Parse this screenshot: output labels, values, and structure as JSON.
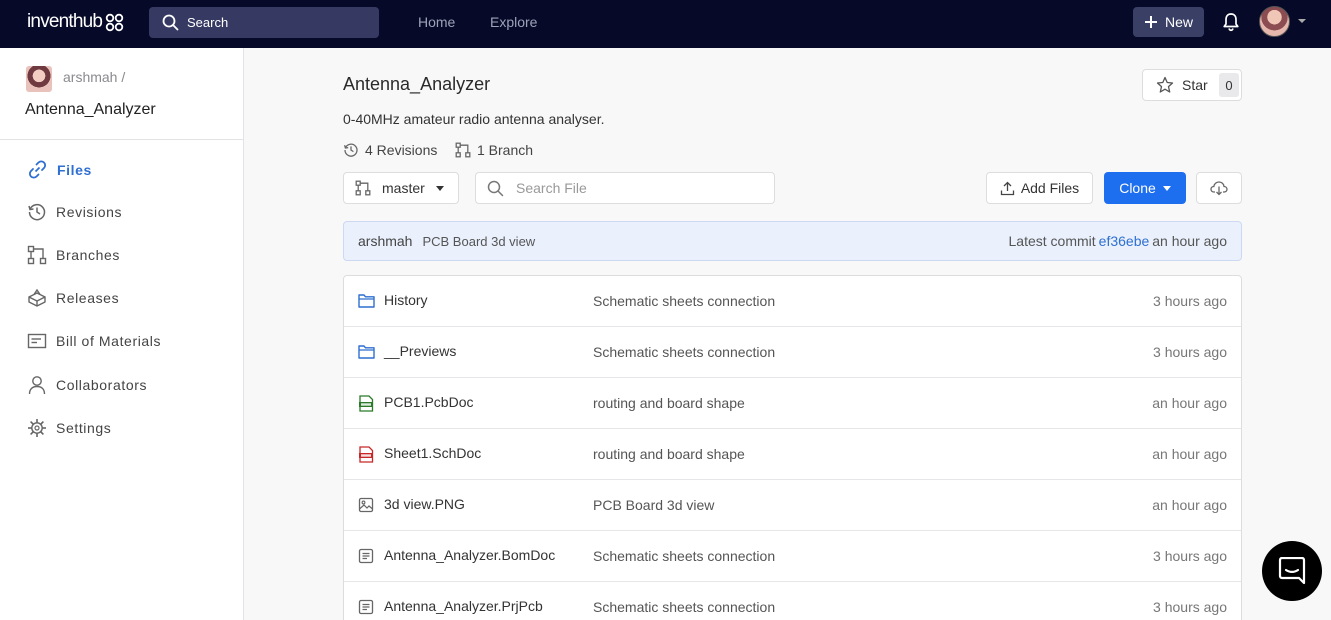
{
  "topbar": {
    "brand": "inventhub",
    "search_placeholder": "Search",
    "nav": [
      {
        "label": "Home"
      },
      {
        "label": "Explore"
      }
    ],
    "new_label": "New"
  },
  "sidebar": {
    "owner": "arshmah /",
    "repo": "Antenna_Analyzer",
    "items": [
      {
        "label": "Files",
        "icon": "link-icon",
        "active": true
      },
      {
        "label": "Revisions",
        "icon": "history-icon"
      },
      {
        "label": "Branches",
        "icon": "branch-icon"
      },
      {
        "label": "Releases",
        "icon": "package-icon"
      },
      {
        "label": "Bill of Materials",
        "icon": "list-box-icon"
      },
      {
        "label": "Collaborators",
        "icon": "user-icon"
      },
      {
        "label": "Settings",
        "icon": "gear-icon"
      }
    ]
  },
  "repo": {
    "title": "Antenna_Analyzer",
    "star_label": "Star",
    "star_count": "0",
    "description": "0-40MHz amateur radio antenna analyser.",
    "revisions": "4 Revisions",
    "branches": "1 Branch"
  },
  "toolbar": {
    "branch": "master",
    "search_placeholder": "Search File",
    "add_files": "Add Files",
    "clone": "Clone"
  },
  "commit": {
    "author": "arshmah",
    "message": "PCB Board 3d view",
    "latest_label": "Latest commit",
    "hash": "ef36ebe",
    "time": "an hour ago"
  },
  "files": [
    {
      "name": "History",
      "type": "folder",
      "message": "Schematic sheets connection",
      "time": "3 hours ago"
    },
    {
      "name": "__Previews",
      "type": "folder",
      "message": "Schematic sheets connection",
      "time": "3 hours ago"
    },
    {
      "name": "PCB1.PcbDoc",
      "type": "pcb",
      "message": "routing and board shape",
      "time": "an hour ago"
    },
    {
      "name": "Sheet1.SchDoc",
      "type": "sch",
      "message": "routing and board shape",
      "time": "an hour ago"
    },
    {
      "name": "3d view.PNG",
      "type": "image",
      "message": "PCB Board 3d view",
      "time": "an hour ago"
    },
    {
      "name": "Antenna_Analyzer.BomDoc",
      "type": "doc",
      "message": "Schematic sheets connection",
      "time": "3 hours ago"
    },
    {
      "name": "Antenna_Analyzer.PrjPcb",
      "type": "doc",
      "message": "Schematic sheets connection",
      "time": "3 hours ago"
    }
  ],
  "colors": {
    "topbar": "#060a28",
    "accent": "#1e6ef0",
    "link": "#2f6fd1",
    "commit_bar": "#eaf1fd"
  }
}
